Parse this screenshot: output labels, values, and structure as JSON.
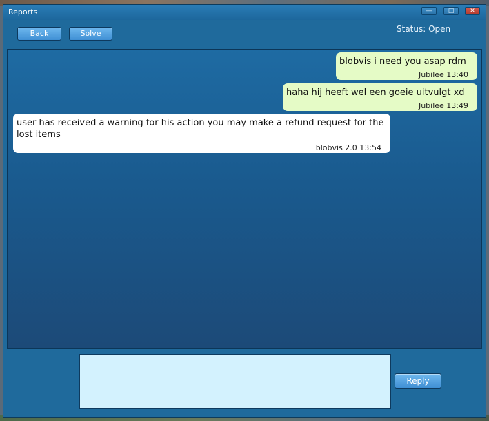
{
  "window": {
    "title": "Reports",
    "controls": {
      "minimize": "—",
      "maximize": "□",
      "close": "✕"
    }
  },
  "toolbar": {
    "back_label": "Back",
    "solve_label": "Solve",
    "status": "Status: Open"
  },
  "messages": [
    {
      "text": "blobvis i need you asap rdm",
      "meta": "Jubilee 13:40",
      "side": "right"
    },
    {
      "text": "haha hij heeft wel een goeie uitvulgt xd",
      "meta": "Jubilee 13:49",
      "side": "right"
    },
    {
      "text": "user has received a warning for his action you may make a refund request for the lost items",
      "meta": "blobvis 2.0 13:54",
      "side": "left"
    }
  ],
  "reply": {
    "value": "",
    "button_label": "Reply"
  },
  "colors": {
    "window_bg": "#1f6a9c",
    "own_bubble": "#e5fbc6",
    "other_bubble": "#ffffff",
    "input_bg": "#d3f2fe",
    "button": "#4f9fe0",
    "close_button": "#c94a3e"
  }
}
